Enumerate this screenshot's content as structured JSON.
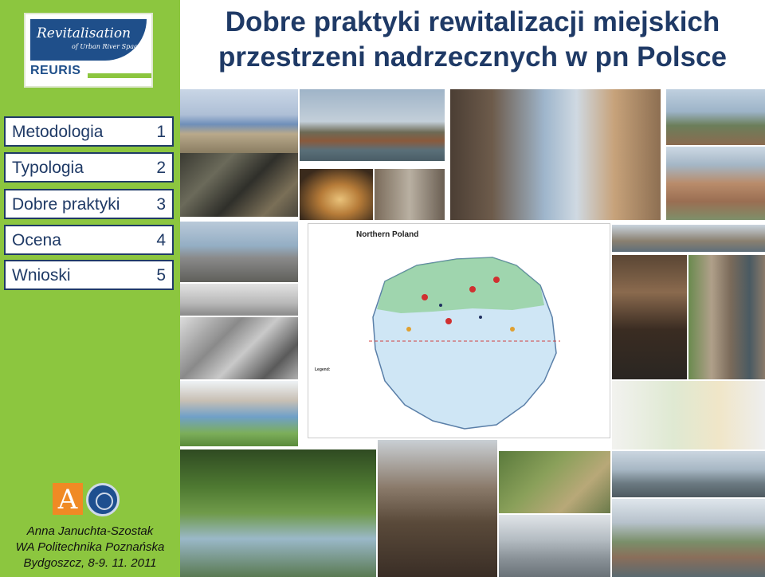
{
  "title_line1": "Dobre praktyki rewitalizacji miejskich",
  "title_line2": "przestrzeni nadrzecznych w pn Polsce",
  "logo": {
    "script": "Revitalisation",
    "sub": "of Urban River Spaces",
    "acronym": "REURIS"
  },
  "menu": [
    {
      "label": "Metodologia",
      "num": "1"
    },
    {
      "label": "Typologia",
      "num": "2"
    },
    {
      "label": "Dobre praktyki",
      "num": "3"
    },
    {
      "label": "Ocena",
      "num": "4"
    },
    {
      "label": "Wnioski",
      "num": "5"
    }
  ],
  "author": {
    "name": "Anna Januchta-Szostak",
    "affiliation": "WA Politechnika Poznańska",
    "place_date": "Bydgoszcz, 8-9. 11. 2011"
  },
  "map": {
    "header": "Northern Poland",
    "legend_title": "Legend:"
  },
  "colors": {
    "sidebar_green": "#8cc63f",
    "navy": "#1f3a66",
    "brand_blue": "#1f4f8a"
  }
}
